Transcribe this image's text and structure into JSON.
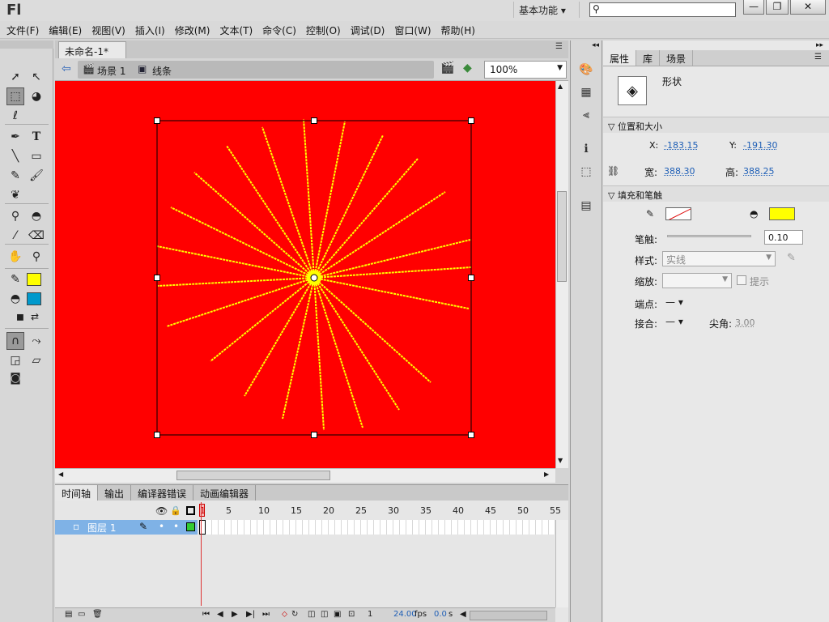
{
  "app": {
    "logo": "Fl",
    "workspace": "基本功能 ▾"
  },
  "menu": [
    "文件(F)",
    "编辑(E)",
    "视图(V)",
    "插入(I)",
    "修改(M)",
    "文本(T)",
    "命令(C)",
    "控制(O)",
    "调试(D)",
    "窗口(W)",
    "帮助(H)"
  ],
  "document": {
    "tab_title": "未命名-1*",
    "tab_close": "×",
    "scene": "场景 1",
    "symbol": "线条",
    "zoom": "100%"
  },
  "stage": {
    "background": "#ff0000",
    "line_color": "#ffff00"
  },
  "timeline": {
    "tabs": [
      "时间轴",
      "输出",
      "编译器错误",
      "动画编辑器"
    ],
    "ruler": [
      "1",
      "5",
      "10",
      "15",
      "20",
      "25",
      "30",
      "35",
      "40",
      "45",
      "50",
      "55"
    ],
    "layer_name": "图层 1",
    "current_frame": "1",
    "fps": "24.00",
    "fps_unit": "fps",
    "time": "0.0",
    "time_unit": "s"
  },
  "properties": {
    "tabs": [
      "属性",
      "库",
      "场景"
    ],
    "object_type": "形状",
    "section_position": "位置和大小",
    "x_label": "X:",
    "x_value": "-183.15",
    "y_label": "Y:",
    "y_value": "-191.30",
    "w_label": "宽:",
    "w_value": "388.30",
    "h_label": "高:",
    "h_value": "388.25",
    "section_fill": "填充和笔触",
    "stroke_label": "笔触:",
    "stroke_value": "0.10",
    "style_label": "样式:",
    "style_value": "实线",
    "scale_label": "缩放:",
    "hint_label": "提示",
    "cap_label": "端点:",
    "join_label": "接合:",
    "miter_label": "尖角:",
    "miter_value": "3.00",
    "fill_color": "#ffff00",
    "tool_fill_color": "#ffff00",
    "tool_stroke_color": "#0099cc"
  }
}
